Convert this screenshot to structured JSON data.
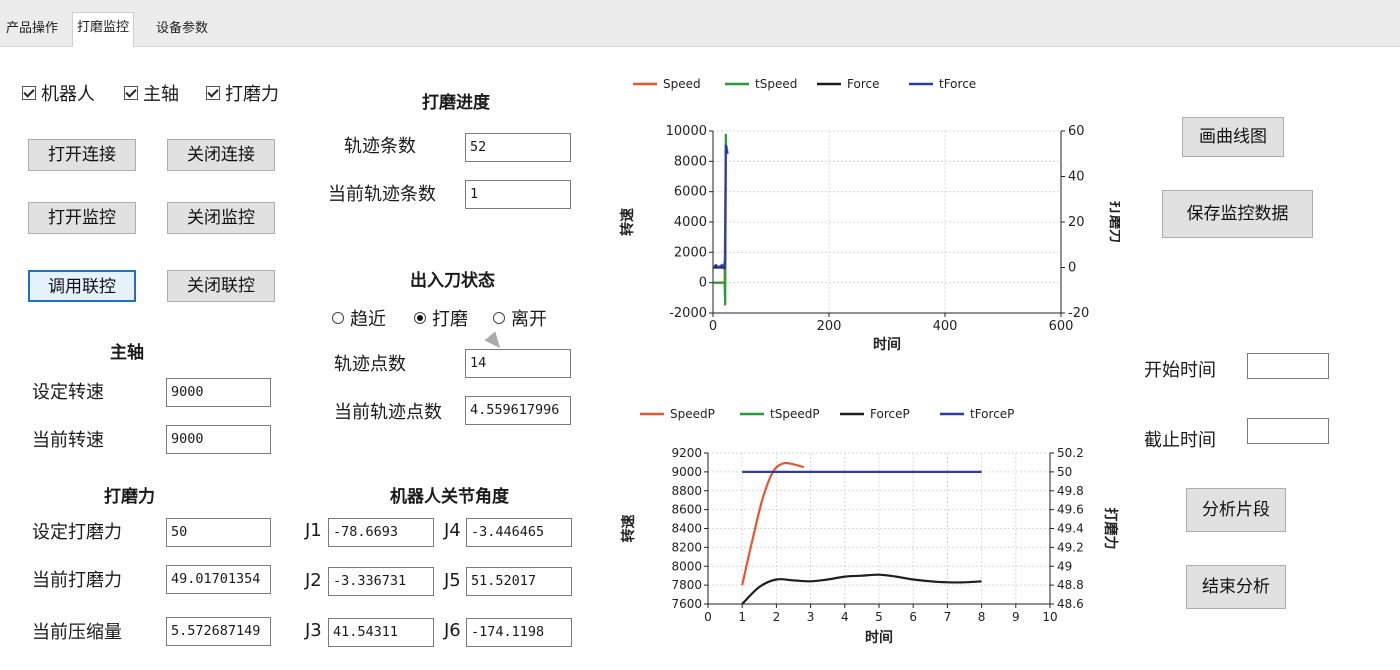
{
  "tabs": [
    "产品操作",
    "打磨监控",
    "设备参数"
  ],
  "checkboxes": [
    "机器人",
    "主轴",
    "打磨力"
  ],
  "buttons": {
    "open_conn": "打开连接",
    "close_conn": "关闭连接",
    "open_monitor": "打开监控",
    "close_monitor": "关闭监控",
    "call_linkage": "调用联控",
    "close_linkage": "关闭联控",
    "draw_curve": "画曲线图",
    "save_data": "保存监控数据",
    "analyze": "分析片段",
    "end_analysis": "结束分析"
  },
  "spindle": {
    "title": "主轴",
    "set_speed_label": "设定转速",
    "set_speed": "9000",
    "cur_speed_label": "当前转速",
    "cur_speed": "9000"
  },
  "force": {
    "title": "打磨力",
    "set_label": "设定打磨力",
    "set_value": "50",
    "cur_label": "当前打磨力",
    "cur_value": "49.01701354",
    "comp_label": "当前压缩量",
    "comp_value": "5.572687149"
  },
  "progress": {
    "title": "打磨进度",
    "traj_count_label": "轨迹条数",
    "traj_count": "52",
    "cur_traj_label": "当前轨迹条数",
    "cur_traj": "1"
  },
  "tool": {
    "title": "出入刀状态",
    "radios": [
      "趋近",
      "打磨",
      "离开"
    ],
    "selected": 1,
    "pts_label": "轨迹点数",
    "pts": "14",
    "cur_pts_label": "当前轨迹点数",
    "cur_pts": "4.559617996"
  },
  "joints": {
    "title": "机器人关节角度",
    "labels": [
      "J1",
      "J2",
      "J3",
      "J4",
      "J5",
      "J6"
    ],
    "values": [
      "-78.6693",
      "-3.336731",
      "41.54311",
      "-3.446465",
      "51.52017",
      "-174.1198"
    ]
  },
  "time": {
    "start_label": "开始时间",
    "start": "",
    "end_label": "截止时间",
    "end": ""
  },
  "colors": {
    "speed": "#e8542f",
    "tspeed": "#2a9a3a",
    "force": "#1e1e1e",
    "tforce": "#2e3aa8"
  },
  "chart_data": [
    {
      "type": "line",
      "legend": [
        "Speed",
        "tSpeed",
        "Force",
        "tForce"
      ],
      "xlabel": "时间",
      "ylabel": "转速",
      "y2label": "打磨力",
      "xlim": [
        0,
        600
      ],
      "ylim": [
        -2000,
        10000
      ],
      "y2lim": [
        -20,
        60
      ],
      "xticks": [
        "0",
        "200",
        "400",
        "600"
      ],
      "yticks": [
        "-2000",
        "0",
        "2000",
        "4000",
        "6000",
        "8000",
        "10000"
      ],
      "y2ticks": [
        "-20",
        "0",
        "20",
        "40",
        "60"
      ],
      "series": [
        {
          "name": "Speed",
          "axis": "y",
          "x": [
            0,
            10,
            20,
            22,
            24
          ],
          "y": [
            0,
            0,
            0,
            9000,
            9000
          ]
        },
        {
          "name": "tSpeed",
          "axis": "y",
          "x": [
            0,
            10,
            20,
            21,
            22,
            23,
            24
          ],
          "y": [
            0,
            0,
            0,
            -1500,
            9800,
            8500,
            9000
          ]
        },
        {
          "name": "Force",
          "axis": "y2",
          "x": [
            0,
            20,
            22
          ],
          "y": [
            0,
            0,
            0
          ]
        },
        {
          "name": "tForce",
          "axis": "y2",
          "x": [
            0,
            5,
            10,
            15,
            18,
            20,
            21,
            22,
            23,
            24,
            25
          ],
          "y": [
            0,
            1,
            0,
            1,
            0,
            2,
            1,
            54,
            50,
            52,
            50
          ]
        }
      ]
    },
    {
      "type": "line",
      "legend": [
        "SpeedP",
        "tSpeedP",
        "ForceP",
        "tForceP"
      ],
      "xlabel": "时间",
      "ylabel": "转速",
      "y2label": "打磨力",
      "xlim": [
        0,
        10
      ],
      "ylim": [
        7600,
        9200
      ],
      "y2lim": [
        48.6,
        50.2
      ],
      "xticks": [
        "0",
        "1",
        "2",
        "3",
        "4",
        "5",
        "6",
        "7",
        "8",
        "9",
        "10"
      ],
      "yticks": [
        "7600",
        "7800",
        "8000",
        "8200",
        "8400",
        "8600",
        "8800",
        "9000",
        "9200"
      ],
      "y2ticks": [
        "48.6",
        "48.8",
        "49",
        "49.2",
        "49.4",
        "49.6",
        "49.8",
        "50",
        "50.2"
      ],
      "series": [
        {
          "name": "SpeedP",
          "axis": "y",
          "x": [
            1,
            1.3,
            1.6,
            1.9,
            2.2,
            2.5,
            2.8
          ],
          "y": [
            7800,
            8280,
            8720,
            9000,
            9090,
            9080,
            9050
          ]
        },
        {
          "name": "ForceP",
          "axis": "y2",
          "x": [
            1,
            1.5,
            2,
            2.5,
            3,
            3.5,
            4,
            4.5,
            5,
            5.5,
            6,
            6.5,
            7,
            7.5,
            8
          ],
          "y": [
            48.6,
            48.78,
            48.86,
            48.85,
            48.84,
            48.86,
            48.89,
            48.9,
            48.91,
            48.89,
            48.86,
            48.84,
            48.83,
            48.83,
            48.84
          ]
        },
        {
          "name": "tForceP",
          "axis": "y2",
          "x": [
            1,
            8
          ],
          "y": [
            50,
            50
          ]
        }
      ]
    }
  ]
}
